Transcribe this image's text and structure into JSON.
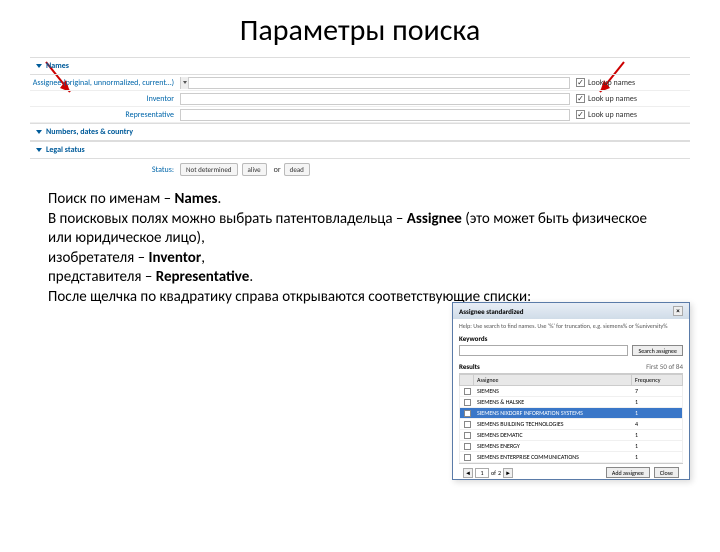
{
  "title": "Параметры поиска",
  "form": {
    "section_names": "Names",
    "rows": [
      {
        "label": "Assignee (original, unnormalized, current…)",
        "opt": "Lookup names"
      },
      {
        "label": "Inventor",
        "opt": "Look up names"
      },
      {
        "label": "Representative",
        "opt": "Look up names"
      }
    ],
    "section_numbers": "Numbers, dates & country",
    "section_legal": "Legal status",
    "status_label": "Status:",
    "status_pills": [
      "Not determined",
      "alive",
      "or",
      "dead"
    ]
  },
  "description": {
    "p1a": "Поиск по именам – ",
    "p1b": "Names",
    "p1c": ".",
    "p2a": "В поисковых полях можно выбрать патентовладельца – ",
    "p2b": "Assignee",
    "p2c": " (это может быть физическое или юридическое лицо),",
    "p3a": "изобретателя – ",
    "p3b": "Inventor",
    "p3c": ",",
    "p4a": "представителя – ",
    "p4b": "Representative",
    "p4c": ".",
    "p5": "После щелчка по квадратику справа открываются соответствующие списки:"
  },
  "popup": {
    "title": "Assignee standardized",
    "hint": "Help: Use search to find names. Use '%' for truncation, e.g. siemens% or %university%",
    "keywords_label": "Keywords",
    "search_btn": "Search assignee",
    "results_label": "Results",
    "results_count": "First 50 of 84",
    "col_assignee": "Assignee",
    "col_freq": "Frequency",
    "rows": [
      {
        "name": "SIEMENS",
        "freq": "7"
      },
      {
        "name": "SIEMENS & HALSKE",
        "freq": "1"
      },
      {
        "name": "SIEMENS NIXDORF INFORMATION SYSTEMS",
        "freq": "1"
      },
      {
        "name": "SIEMENS BUILDING TECHNOLOGIES",
        "freq": "4"
      },
      {
        "name": "SIEMENS DEMATIC",
        "freq": "1"
      },
      {
        "name": "SIEMENS ENERGY",
        "freq": "1"
      },
      {
        "name": "SIEMENS ENTERPRISE COMMUNICATIONS",
        "freq": "1"
      }
    ],
    "selected_index": 2,
    "pager": {
      "prev": "◄",
      "page": "1",
      "of_label": "of",
      "total": "2",
      "next": "►"
    },
    "add_btn": "Add assignee",
    "close_btn": "Close"
  }
}
